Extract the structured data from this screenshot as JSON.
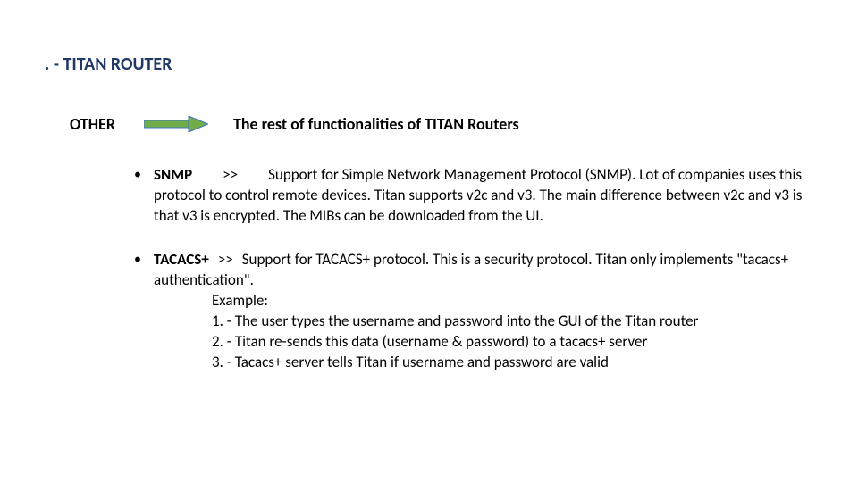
{
  "slide": {
    "title": ". - TITAN ROUTER"
  },
  "section": {
    "label": "OTHER",
    "subtitle": "The rest of functionalities of TITAN Routers"
  },
  "arrow": {
    "fill": "#70AD47",
    "stroke": "#4472C4"
  },
  "bullets": [
    {
      "term": "SNMP",
      "sep": ">>",
      "desc": "Support for Simple Network Management Protocol (SNMP). Lot of companies uses this protocol to control remote devices. Titan supports v2c and v3. The main difference between v2c and v3 is that v3 is encrypted. The MIBs can be downloaded from the UI."
    },
    {
      "term": "TACACS+",
      "sep": ">>",
      "desc_lead": "Support for TACACS+ protocol.  This is a security protocol. Titan only implements \"tacacs+ authentication\".",
      "example_label": "Example:",
      "steps": [
        "1. - The user types the username and password into the GUI of the Titan router",
        "2. - Titan re-sends this data (username & password) to a tacacs+ server",
        "3. - Tacacs+ server tells Titan if username and password are valid"
      ]
    }
  ]
}
